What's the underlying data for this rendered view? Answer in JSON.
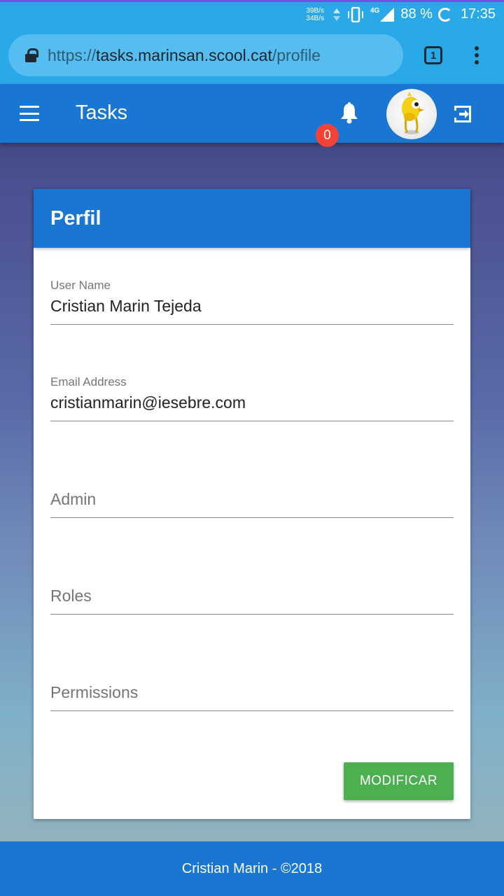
{
  "status_bar": {
    "speed_up": "39B/s",
    "speed_down": "34B/s",
    "network": "4G",
    "battery": "88 %",
    "time": "17:35"
  },
  "browser": {
    "url_scheme": "https://",
    "url_host": "tasks.marinsan.scool.cat",
    "url_path": "/profile",
    "tab_count": "1"
  },
  "app_bar": {
    "title": "Tasks",
    "notifications_count": "0"
  },
  "card": {
    "title": "Perfil",
    "fields": [
      {
        "label": "User Name",
        "value": "Cristian Marin Tejeda"
      },
      {
        "label": "Email Address",
        "value": "cristianmarin@iesebre.com"
      },
      {
        "placeholder": "Admin"
      },
      {
        "placeholder": "Roles"
      },
      {
        "placeholder": "Permissions"
      }
    ],
    "button_label": "MODIFICAR"
  },
  "footer": {
    "text": "Cristian Marin - ©2018"
  },
  "colors": {
    "primary": "#1976d2",
    "browser": "#2aa9e8",
    "badge": "#f44336",
    "button": "#4caf50"
  }
}
